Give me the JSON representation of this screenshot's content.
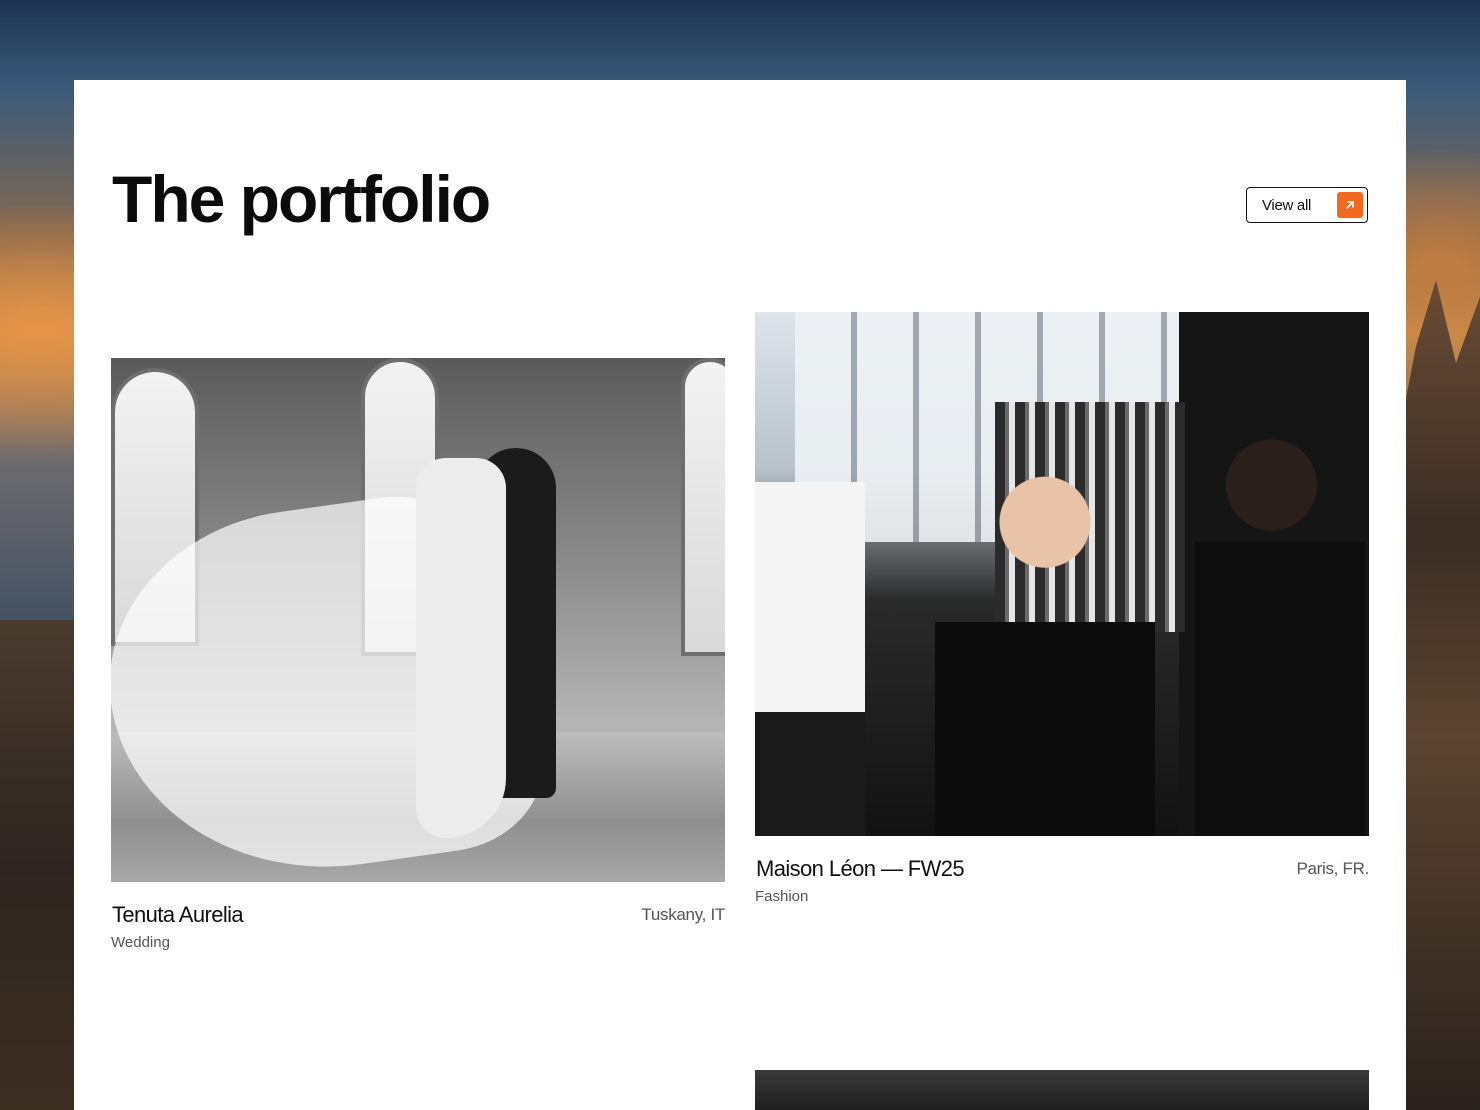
{
  "page": {
    "title": "The portfolio",
    "view_all_label": "View all",
    "view_all_icon": "arrow-up-right-icon",
    "accent_color": "#f26a21"
  },
  "projects": [
    {
      "name": "Tenuta Aurelia",
      "location": "Tuskany, IT",
      "category": "Wedding"
    },
    {
      "name": "Maison Léon — FW25",
      "location": "Paris, FR.",
      "category": "Fashion"
    }
  ]
}
